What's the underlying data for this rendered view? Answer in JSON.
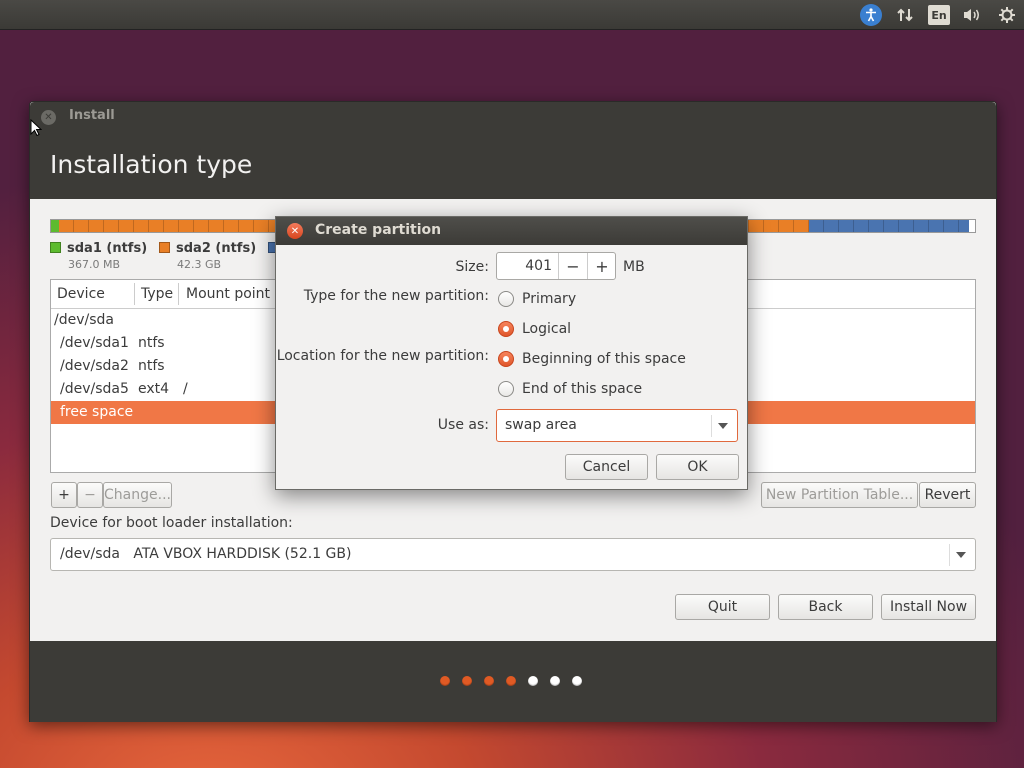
{
  "topbar": {
    "lang": "En",
    "accessibility_icon": "accessibility-icon",
    "network_icon": "network-icon",
    "volume_icon": "volume-icon",
    "settings_icon": "gear-icon"
  },
  "window": {
    "title": "Install",
    "heading": "Installation type"
  },
  "partition_bar": {
    "colors": {
      "sda1": "#5dbb2f",
      "sda2": "#e97f26",
      "sda5": "#4a74b0"
    }
  },
  "legend": [
    {
      "name": "sda1 (ntfs)",
      "size": "367.0 MB"
    },
    {
      "name": "sda2 (ntfs)",
      "size": "42.3 GB"
    }
  ],
  "table": {
    "headers": [
      "Device",
      "Type",
      "Mount point"
    ],
    "rows": [
      {
        "device": "/dev/sda",
        "type": "",
        "mount": ""
      },
      {
        "device": "/dev/sda1",
        "type": "ntfs",
        "mount": ""
      },
      {
        "device": "/dev/sda2",
        "type": "ntfs",
        "mount": ""
      },
      {
        "device": "/dev/sda5",
        "type": "ext4",
        "mount": "/"
      },
      {
        "device": "free space",
        "type": "",
        "mount": ""
      }
    ]
  },
  "table_actions": {
    "add": "+",
    "remove": "−",
    "change": "Change...",
    "new_table": "New Partition Table...",
    "revert": "Revert"
  },
  "bootloader": {
    "label": "Device for boot loader installation:",
    "device": "/dev/sda",
    "desc": "ATA VBOX HARDDISK (52.1 GB)"
  },
  "nav": {
    "quit": "Quit",
    "back": "Back",
    "install": "Install Now"
  },
  "steps": {
    "total": 7,
    "active": 4
  },
  "dialog": {
    "title": "Create partition",
    "size_label": "Size:",
    "size_value": "401",
    "size_unit": "MB",
    "minus": "−",
    "plus": "+",
    "type_label": "Type for the new partition:",
    "type_primary": "Primary",
    "type_logical": "Logical",
    "location_label": "Location for the new partition:",
    "loc_begin": "Beginning of this space",
    "loc_end": "End of this space",
    "use_label": "Use as:",
    "use_value": "swap area",
    "cancel": "Cancel",
    "ok": "OK"
  }
}
